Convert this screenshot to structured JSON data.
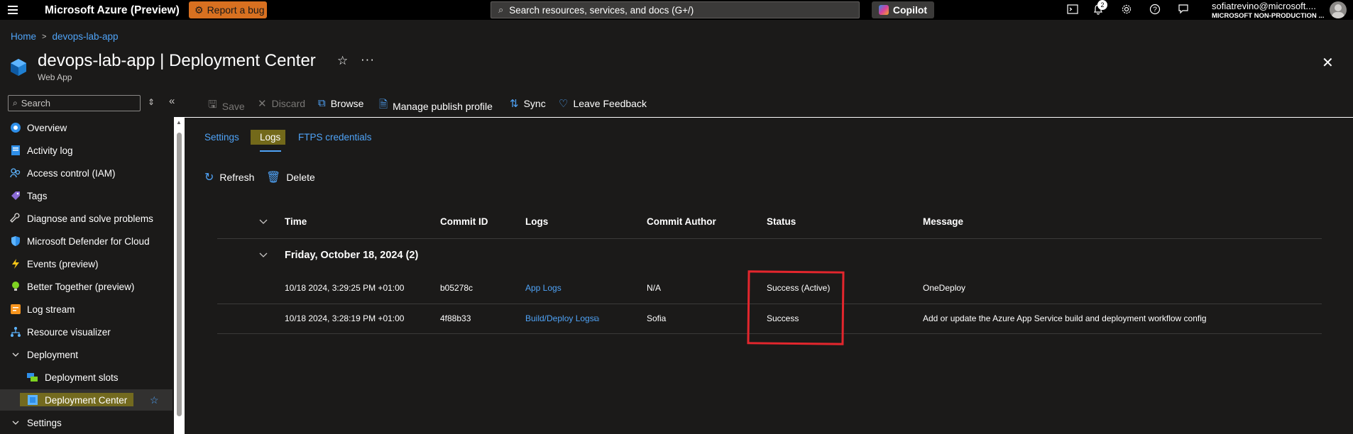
{
  "topbar": {
    "brand": "Microsoft Azure (Preview)",
    "bug_button": "Report a bug",
    "search_placeholder": "Search resources, services, and docs (G+/)",
    "copilot": "Copilot",
    "notification_count": "2",
    "user_email": "sofiatrevino@microsoft....",
    "user_org": "MICROSOFT NON-PRODUCTION ...",
    "icons": [
      "menu-icon",
      "bug-icon",
      "search-icon",
      "copilot-icon",
      "cloud-shell-icon",
      "bell-icon",
      "gear-icon",
      "help-icon",
      "feedback-icon",
      "avatar"
    ]
  },
  "breadcrumb": {
    "home": "Home",
    "resource": "devops-lab-app"
  },
  "header": {
    "title_resource": "devops-lab-app",
    "title_sep": " | ",
    "title_page": "Deployment Center",
    "subtitle": "Web App"
  },
  "nav": {
    "search_placeholder": "Search",
    "items": [
      {
        "label": "Overview",
        "icon": "globe-icon"
      },
      {
        "label": "Activity log",
        "icon": "log-icon"
      },
      {
        "label": "Access control (IAM)",
        "icon": "people-icon"
      },
      {
        "label": "Tags",
        "icon": "tag-icon"
      },
      {
        "label": "Diagnose and solve problems",
        "icon": "wrench-icon"
      },
      {
        "label": "Microsoft Defender for Cloud",
        "icon": "shield-icon"
      },
      {
        "label": "Events (preview)",
        "icon": "lightning-icon"
      },
      {
        "label": "Better Together (preview)",
        "icon": "bulb-icon"
      },
      {
        "label": "Log stream",
        "icon": "stream-icon"
      },
      {
        "label": "Resource visualizer",
        "icon": "hierarchy-icon"
      },
      {
        "label": "Deployment",
        "icon": "chevron-down-icon"
      },
      {
        "label": "Deployment slots",
        "icon": "slots-icon"
      },
      {
        "label": "Deployment Center",
        "icon": "cube-icon"
      },
      {
        "label": "Settings",
        "icon": "chevron-down-icon"
      }
    ]
  },
  "commands": {
    "save": "Save",
    "discard": "Discard",
    "browse": "Browse",
    "manage_profile": "Manage publish profile",
    "sync": "Sync",
    "feedback": "Leave Feedback"
  },
  "tabs": {
    "settings": "Settings",
    "logs": "Logs",
    "ftps": "FTPS credentials"
  },
  "actions": {
    "refresh": "Refresh",
    "delete": "Delete"
  },
  "table": {
    "headers": [
      "Time",
      "Commit ID",
      "Logs",
      "Commit Author",
      "Status",
      "Message"
    ],
    "group": "Friday, October 18, 2024 (2)",
    "rows": [
      {
        "time": "10/18 2024, 3:29:25 PM +01:00",
        "commit": "b05278c",
        "logs": "App Logs",
        "author": "N/A",
        "status": "Success (Active)",
        "message": "OneDeploy"
      },
      {
        "time": "10/18 2024, 3:28:19 PM +01:00",
        "commit": "4f88b33",
        "logs": "Build/Deploy Logs",
        "author": "Sofia",
        "status": "Success",
        "message": "Add or update the Azure App Service build and deployment workflow config"
      }
    ]
  },
  "colors": {
    "accent": "#4fa3f7",
    "highlight": "#8a7d1a",
    "annotation": "#e3262d",
    "bug": "#d87020"
  }
}
